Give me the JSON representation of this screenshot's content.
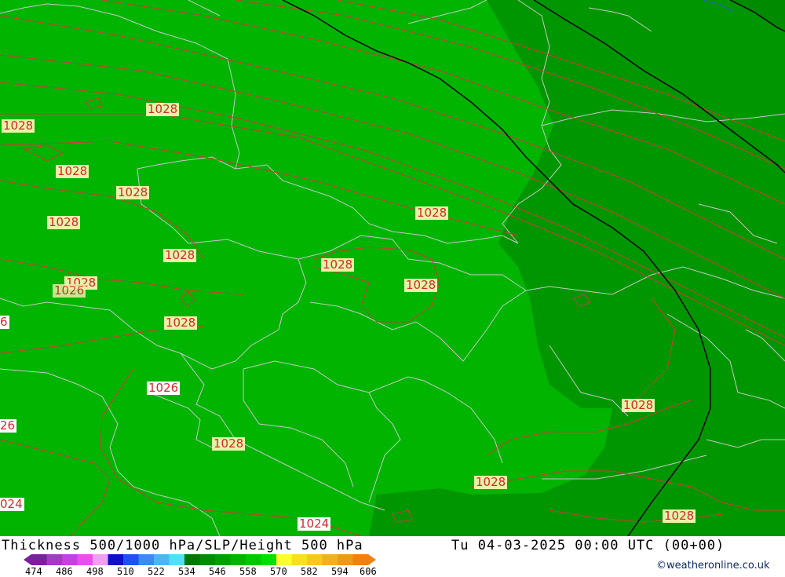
{
  "colors": {
    "fill_light": "#00b400",
    "fill_dark": "#009600",
    "fill_darkest": "#008600",
    "isobar": "#d03a3a",
    "height_contour": "#000000",
    "border": "#c8c8c8",
    "label_bg": "#e9f2a8"
  },
  "map": {
    "isobar_labels": [
      {
        "text": "1028"
      },
      {
        "text": "1028"
      },
      {
        "text": "1028"
      },
      {
        "text": "1028"
      },
      {
        "text": "1028"
      },
      {
        "text": "1028"
      },
      {
        "text": "1028"
      },
      {
        "text": "1028"
      },
      {
        "text": "1028"
      },
      {
        "text": "1026"
      },
      {
        "text": "6"
      },
      {
        "text": "1028"
      },
      {
        "text": "1026"
      },
      {
        "text": "26"
      },
      {
        "text": "1028"
      },
      {
        "text": "024"
      },
      {
        "text": "1024"
      },
      {
        "text": "1028"
      },
      {
        "text": "1028"
      },
      {
        "text": "1028"
      },
      {
        "text": "1028"
      }
    ]
  },
  "footer": {
    "title": "Thickness 500/1000 hPa/SLP/Height 500 hPa",
    "run": "Tu 04-03-2025 00:00 UTC (00+00)",
    "credit": "©weatheronline.co.uk"
  },
  "legend": {
    "labels": [
      "474",
      "486",
      "498",
      "510",
      "522",
      "534",
      "546",
      "558",
      "570",
      "582",
      "594",
      "606"
    ],
    "colors": [
      "#7a1fa0",
      "#a23ac8",
      "#c83ee0",
      "#e84ef0",
      "#f0a0f0",
      "#1010c8",
      "#2050f0",
      "#3a8cf0",
      "#4ab8f0",
      "#50e0f8",
      "#007800",
      "#008c00",
      "#00a000",
      "#00b400",
      "#00c800",
      "#00e000",
      "#ffff30",
      "#f8e020",
      "#f8c820",
      "#f0b020",
      "#f09818",
      "#f08010"
    ]
  }
}
